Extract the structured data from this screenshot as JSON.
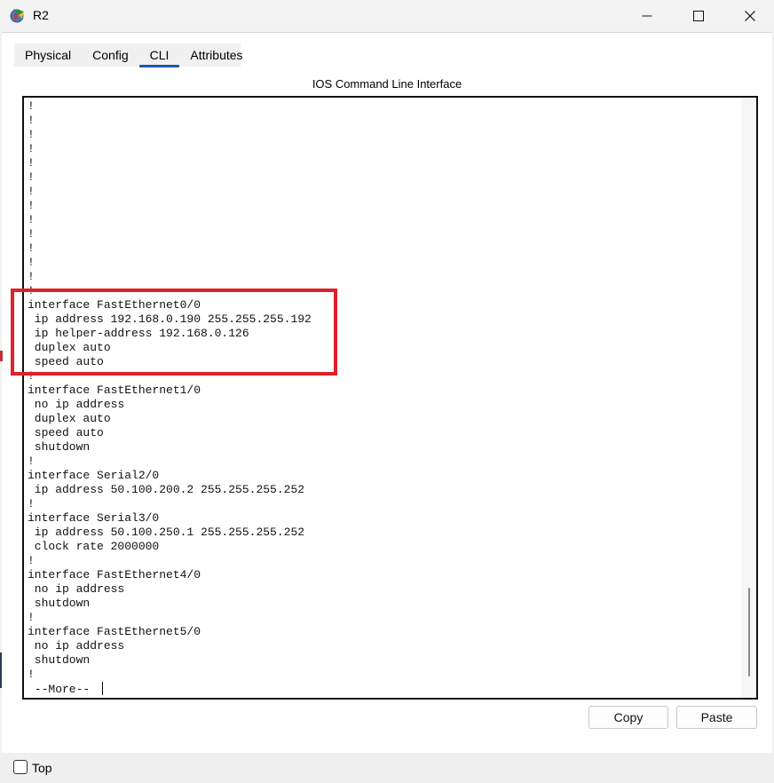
{
  "window": {
    "title": "R2",
    "icon": "router-app-icon"
  },
  "tabs": [
    {
      "label": "Physical",
      "active": false
    },
    {
      "label": "Config",
      "active": false
    },
    {
      "label": "CLI",
      "active": true
    },
    {
      "label": "Attributes",
      "active": false
    }
  ],
  "cli": {
    "heading": "IOS Command Line Interface",
    "lines": [
      "!",
      "!",
      "!",
      "!",
      "!",
      "!",
      "!",
      "!",
      "!",
      "!",
      "!",
      "!",
      "!",
      "!",
      "interface FastEthernet0/0",
      " ip address 192.168.0.190 255.255.255.192",
      " ip helper-address 192.168.0.126",
      " duplex auto",
      " speed auto",
      "!",
      "interface FastEthernet1/0",
      " no ip address",
      " duplex auto",
      " speed auto",
      " shutdown",
      "!",
      "interface Serial2/0",
      " ip address 50.100.200.2 255.255.255.252",
      "!",
      "interface Serial3/0",
      " ip address 50.100.250.1 255.255.255.252",
      " clock rate 2000000",
      "!",
      "interface FastEthernet4/0",
      " no ip address",
      " shutdown",
      "!",
      "interface FastEthernet5/0",
      " no ip address",
      " shutdown",
      "!"
    ],
    "prompt": " --More-- ",
    "highlight_color": "#e0202a"
  },
  "buttons": {
    "copy": "Copy",
    "paste": "Paste"
  },
  "bottom": {
    "top_label": "Top",
    "top_checked": false
  }
}
